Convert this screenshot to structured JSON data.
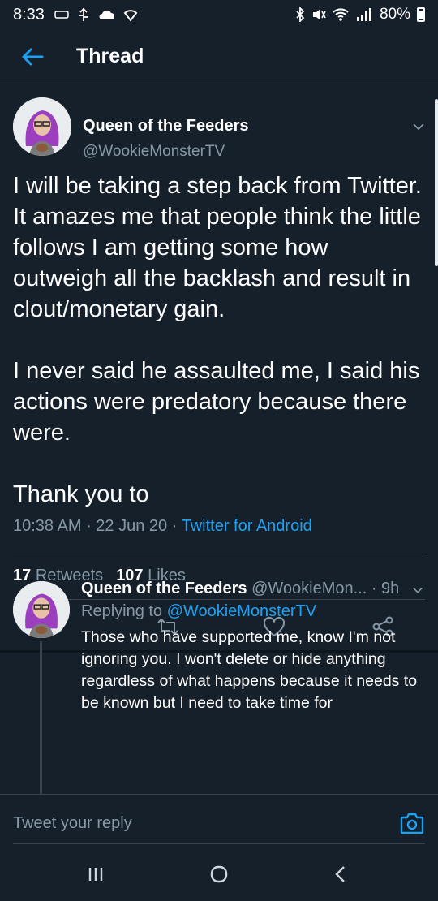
{
  "status_bar": {
    "time": "8:33",
    "battery": "80%",
    "left_icons": [
      "notification-icon",
      "usb-icon",
      "cloud-icon",
      "vpn-icon"
    ],
    "right_icons": [
      "bluetooth-icon",
      "mute-icon",
      "wifi-icon",
      "lte-signal-icon"
    ]
  },
  "header": {
    "title": "Thread"
  },
  "tweet": {
    "author_name": "Queen of the Feeders",
    "author_handle": "@WookieMonsterTV",
    "paragraphs": [
      "I will be taking a step back from Twitter. It amazes me that people think the little follows I am getting some how outweigh all the backlash and result in clout/monetary gain.",
      "I never said he assaulted me, I said his actions were predatory because there were.",
      "Thank you to"
    ],
    "time": "10:38 AM",
    "date": "22 Jun 20",
    "source": "Twitter for Android",
    "retweets_count": "17",
    "retweets_label": "Retweets",
    "likes_count": "107",
    "likes_label": "Likes"
  },
  "reply": {
    "author_name": "Queen of the Feeders",
    "author_handle": "@WookieMon...",
    "age": "· 9h",
    "replying_prefix": "Replying to",
    "replying_to": "@WookieMonsterTV",
    "text": "Those who have supported me, know I'm not ignoring you. I won't delete or hide anything regardless of what happens because it needs to be known but I need to take time for"
  },
  "composer": {
    "placeholder": "Tweet your reply"
  },
  "colors": {
    "background": "#15202b",
    "accent": "#1da1f2",
    "secondary_text": "#8899a6",
    "border": "#38444d"
  }
}
